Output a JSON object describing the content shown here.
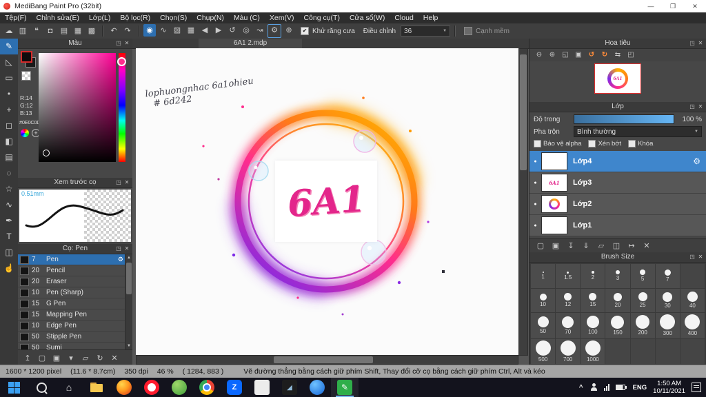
{
  "icons": {
    "minimize": "—",
    "restore": "❐",
    "close": "✕",
    "popout": "◳",
    "panel_close": "✕",
    "undo": "↶",
    "redo": "↷",
    "dropdown": "▼",
    "check": "✔",
    "gear": "⚙",
    "dot": "●",
    "scroll_up": "▲",
    "scroll_down": "▼",
    "plus": "+"
  },
  "titlebar": {
    "app_title": "MediBang Paint Pro (32bit)"
  },
  "menubar": {
    "items": [
      "Tệp(F)",
      "Chỉnh sửa(E)",
      "Lớp(L)",
      "Bộ lọc(R)",
      "Chọn(S)",
      "Chụp(N)",
      "Màu (C)",
      "Xem(V)",
      "Công cụ(T)",
      "Cửa sổ(W)",
      "Cloud",
      "Help"
    ]
  },
  "toolbar": {
    "file_icons": [
      {
        "name": "cloud-icon",
        "glyph": "☁"
      },
      {
        "name": "clipboard-icon",
        "glyph": "▥"
      },
      {
        "name": "comment-icon",
        "glyph": "❝"
      },
      {
        "name": "snapshot-icon",
        "glyph": "◘"
      },
      {
        "name": "pages-icon",
        "glyph": "▤"
      },
      {
        "name": "grid-icon",
        "glyph": "▦"
      },
      {
        "name": "pixel-grid-icon",
        "glyph": "▩"
      }
    ],
    "option_icons": [
      {
        "name": "brush-options-icon",
        "glyph": "◉",
        "selected": true
      },
      {
        "name": "stroke-icon",
        "glyph": "∿"
      },
      {
        "name": "hatch-icon",
        "glyph": "▨"
      },
      {
        "name": "mesh-icon",
        "glyph": "▦"
      },
      {
        "name": "prev-icon",
        "glyph": "◀"
      },
      {
        "name": "next-icon",
        "glyph": "▶"
      },
      {
        "name": "spiral-icon",
        "glyph": "↺"
      },
      {
        "name": "concentric-icon",
        "glyph": "◎"
      },
      {
        "name": "curve-icon",
        "glyph": "↝"
      },
      {
        "name": "snap-settings-icon",
        "glyph": "⚙",
        "outlined": true
      },
      {
        "name": "crosshair-icon",
        "glyph": "⊕"
      }
    ],
    "antialias_label": "Khử răng cưa",
    "adjust_label": "Điều chỉnh",
    "adjust_value": "36",
    "soft_edge_label": "Cạnh mềm"
  },
  "tool_strip": [
    {
      "name": "brush-tool",
      "glyph": "✎",
      "selected": true
    },
    {
      "name": "eraser-tool",
      "glyph": "◺"
    },
    {
      "name": "marquee-tool",
      "glyph": "▭"
    },
    {
      "name": "dot-pen-tool",
      "glyph": "•"
    },
    {
      "name": "move-tool",
      "glyph": "+"
    },
    {
      "name": "select-tool",
      "glyph": "◻"
    },
    {
      "name": "bucket-tool",
      "glyph": "◧"
    },
    {
      "name": "gradient-tool",
      "glyph": "▤"
    },
    {
      "name": "lasso-tool",
      "glyph": "◌"
    },
    {
      "name": "wand-tool",
      "glyph": "☆"
    },
    {
      "name": "smudge-tool",
      "glyph": "∿"
    },
    {
      "name": "nib-tool",
      "glyph": "✒"
    },
    {
      "name": "text-tool",
      "glyph": "T"
    },
    {
      "name": "frame-tool",
      "glyph": "◫"
    },
    {
      "name": "hand-tool",
      "glyph": "☝"
    }
  ],
  "color_panel": {
    "title": "Màu",
    "r": "R:14",
    "g": "G:12",
    "b": "B:13",
    "hex": "#0E0C0D"
  },
  "preview_panel": {
    "title": "Xem trước cọ",
    "width_label": "0.51mm"
  },
  "brushes_panel": {
    "title": "Cọ: Pen",
    "items": [
      {
        "size": "7",
        "name": "Pen",
        "selected": true
      },
      {
        "size": "20",
        "name": "Pencil"
      },
      {
        "size": "20",
        "name": "Eraser"
      },
      {
        "size": "10",
        "name": "Pen (Sharp)"
      },
      {
        "size": "15",
        "name": "G Pen"
      },
      {
        "size": "15",
        "name": "Mapping Pen"
      },
      {
        "size": "10",
        "name": "Edge Pen"
      },
      {
        "size": "50",
        "name": "Stipple Pen"
      },
      {
        "size": "50",
        "name": "Sumi"
      }
    ]
  },
  "brush_actions": [
    {
      "name": "dock-icon",
      "glyph": "↥"
    },
    {
      "name": "add-brush-icon",
      "glyph": "▢"
    },
    {
      "name": "duplicate-brush-icon",
      "glyph": "▣"
    },
    {
      "name": "brush-menu-icon",
      "glyph": "▾"
    },
    {
      "name": "brush-folder-icon",
      "glyph": "▱"
    },
    {
      "name": "brush-sync-icon",
      "glyph": "↻"
    },
    {
      "name": "delete-brush-icon",
      "glyph": "✕"
    }
  ],
  "canvas": {
    "tab": "6A1 2.mdp",
    "logo_text": "6A1",
    "note_line1": "lophuongnhac 6a1ohieu",
    "note_line2": "# 6d242"
  },
  "navigator": {
    "title": "Hoa tiêu",
    "icons": [
      {
        "name": "zoom-out-icon",
        "glyph": "⊖"
      },
      {
        "name": "zoom-in-icon",
        "glyph": "⊕"
      },
      {
        "name": "fit-screen-icon",
        "glyph": "◱"
      },
      {
        "name": "actual-pixels-icon",
        "glyph": "▣"
      },
      {
        "name": "rotate-left-icon",
        "glyph": "↺",
        "accent": true
      },
      {
        "name": "rotate-right-icon",
        "glyph": "↻",
        "accent": true
      },
      {
        "name": "flip-icon",
        "glyph": "⇆"
      },
      {
        "name": "copy-view-icon",
        "glyph": "◰"
      }
    ]
  },
  "layers_panel": {
    "title": "Lớp",
    "opacity_label": "Độ trong",
    "opacity_value": "100 %",
    "blend_label": "Pha trộn",
    "blend_value": "Bình thường",
    "checkboxes": [
      "Bảo vệ alpha",
      "Xén bớt",
      "Khóa"
    ],
    "items": [
      {
        "name": "Lớp4",
        "selected": true,
        "thumb": "checker"
      },
      {
        "name": "Lớp3",
        "thumb": "text"
      },
      {
        "name": "Lớp2",
        "thumb": "ring"
      },
      {
        "name": "Lớp1",
        "thumb": "checker"
      }
    ],
    "actions": [
      {
        "name": "add-layer-icon",
        "glyph": "▢"
      },
      {
        "name": "duplicate-layer-icon",
        "glyph": "▣"
      },
      {
        "name": "transfer-layer-icon",
        "glyph": "↧"
      },
      {
        "name": "merge-down-icon",
        "glyph": "⇓"
      },
      {
        "name": "layer-folder-icon",
        "glyph": "▱"
      },
      {
        "name": "combine-layer-icon",
        "glyph": "◫"
      },
      {
        "name": "move-layer-icon",
        "glyph": "↦"
      },
      {
        "name": "delete-layer-icon",
        "glyph": "✕"
      }
    ]
  },
  "brush_size_panel": {
    "title": "Brush Size",
    "rows": [
      [
        "1",
        "1.5",
        "2",
        "3",
        "5",
        "7"
      ],
      [
        "10",
        "12",
        "15",
        "20",
        "25",
        "30",
        "40"
      ],
      [
        "50",
        "70",
        "100",
        "150",
        "200",
        "300",
        "400"
      ],
      [
        "500",
        "700",
        "1000"
      ]
    ]
  },
  "statusbar": {
    "pixels": "1600 * 1200 pixel",
    "cm": "(11.6 * 8.7cm)",
    "dpi": "350 dpi",
    "zoom": "46 %",
    "coords": "( 1284, 883 )",
    "hint": "Vẽ đường thẳng bằng cách giữ phím Shift, Thay đổi cỡ cọ bằng cách giữ phím Ctrl, Alt và kéo"
  },
  "taskbar": {
    "apps": [
      {
        "name": "museum-app-icon",
        "style": "plain",
        "glyph": "⌂"
      },
      {
        "name": "file-explorer-icon",
        "style": "folder"
      },
      {
        "name": "firefox-icon",
        "style": "firefox"
      },
      {
        "name": "opera-icon",
        "style": "opera"
      },
      {
        "name": "coccoc-icon",
        "style": "green"
      },
      {
        "name": "chrome-icon",
        "style": "chrome"
      },
      {
        "name": "zalo-icon",
        "style": "zalo",
        "glyph": "Z"
      },
      {
        "name": "white-app-icon",
        "style": "white"
      },
      {
        "name": "photos-app-icon",
        "style": "dark",
        "glyph": "◢"
      },
      {
        "name": "browser-app-icon",
        "style": "blue"
      },
      {
        "name": "medibang-app-icon",
        "style": "medibang",
        "glyph": "✎",
        "active": true
      }
    ],
    "lang": "ENG",
    "time": "1:50 AM",
    "date": "10/11/2021"
  },
  "colors": {
    "accent_blue": "#2d6fb0",
    "ring_orange": "#ffb000",
    "ring_pink": "#ff2d8d",
    "ring_purple": "#7d2ae8",
    "logo_pink": "#e3268b"
  }
}
